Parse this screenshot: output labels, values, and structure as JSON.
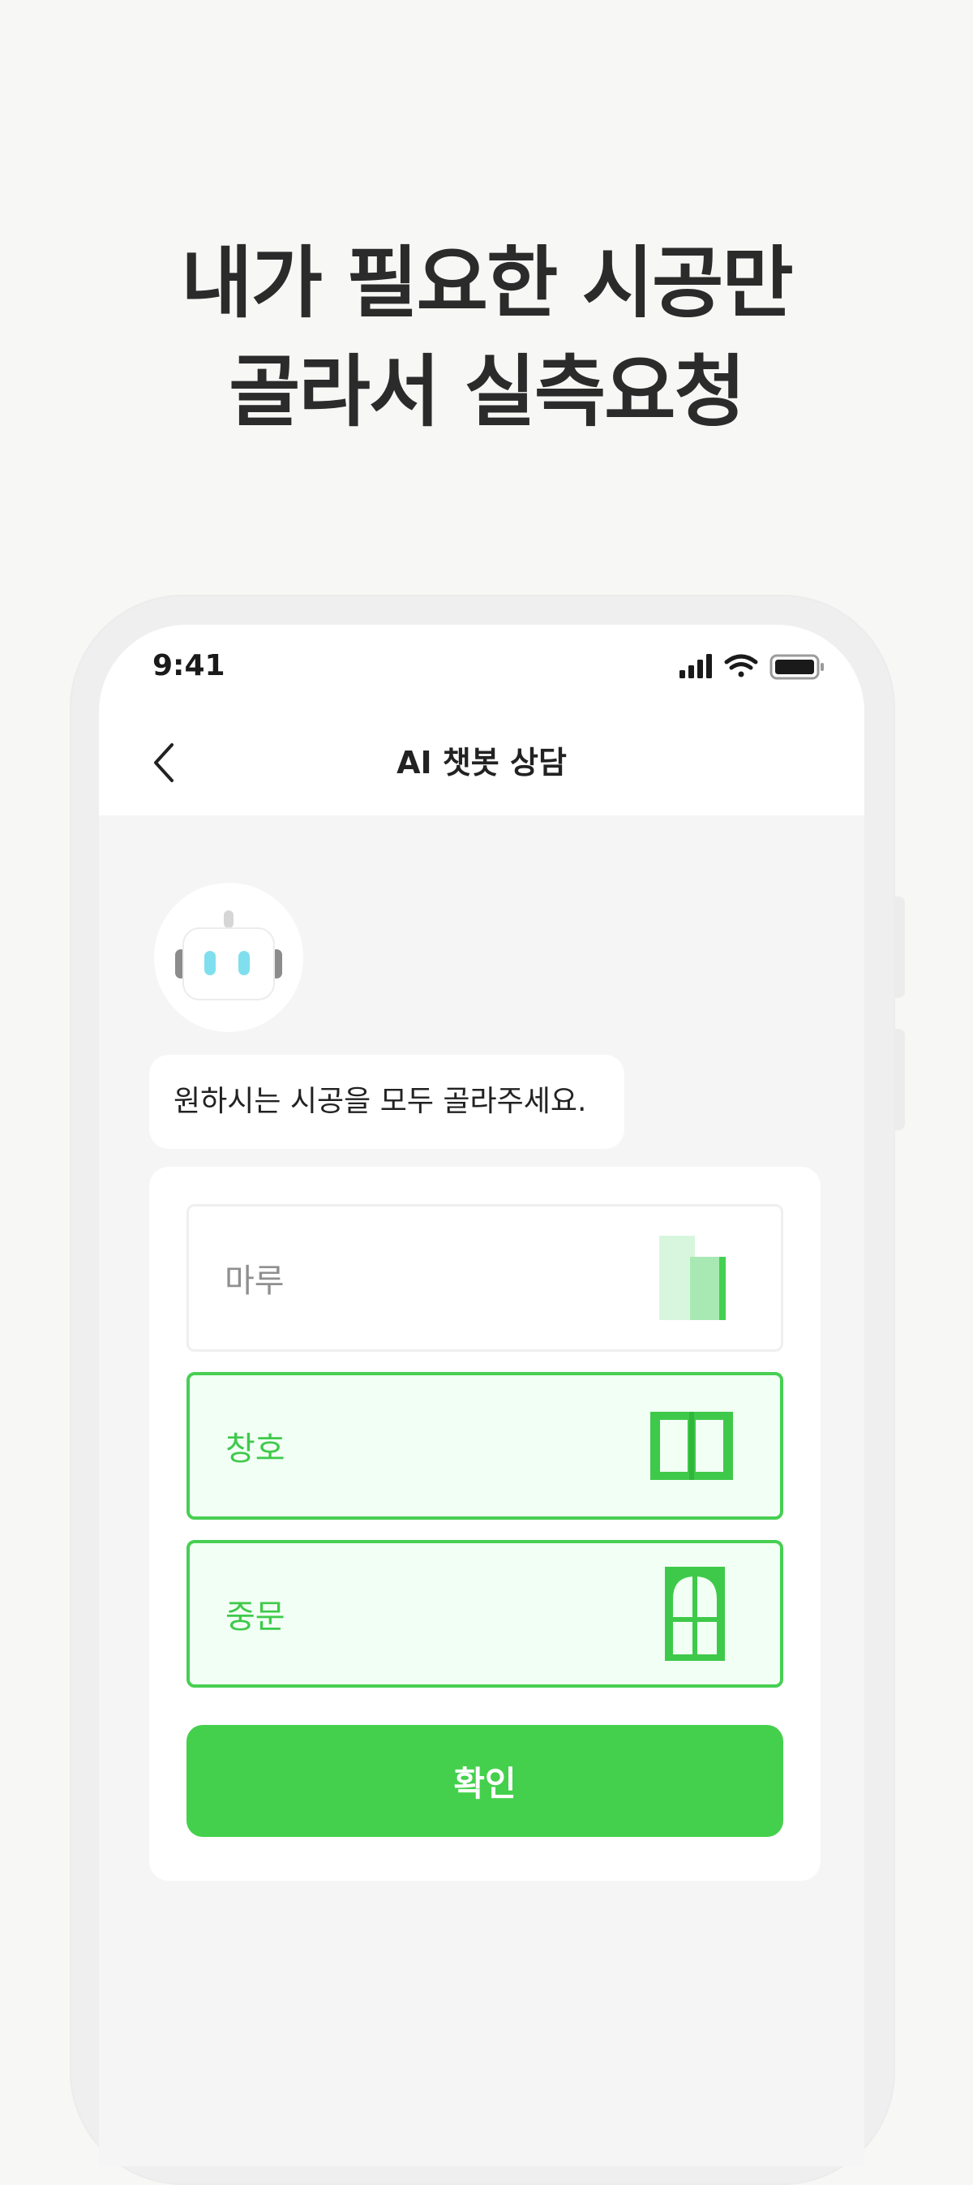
{
  "headline": {
    "line1": "내가 필요한 시공만",
    "line2": "골라서 실측요청"
  },
  "status_bar": {
    "time": "9:41"
  },
  "nav": {
    "title": "AI 챗봇 상담"
  },
  "chat": {
    "bot_message": "원하시는 시공을 모두 골라주세요."
  },
  "options": [
    {
      "label": "마루",
      "icon": "floor-icon",
      "selected": false
    },
    {
      "label": "창호",
      "icon": "window-icon",
      "selected": true
    },
    {
      "label": "중문",
      "icon": "door-icon",
      "selected": true
    }
  ],
  "confirm_label": "확인",
  "colors": {
    "accent": "#44d04c",
    "selected_bg": "#f1fff4",
    "background": "#f7f7f6"
  }
}
